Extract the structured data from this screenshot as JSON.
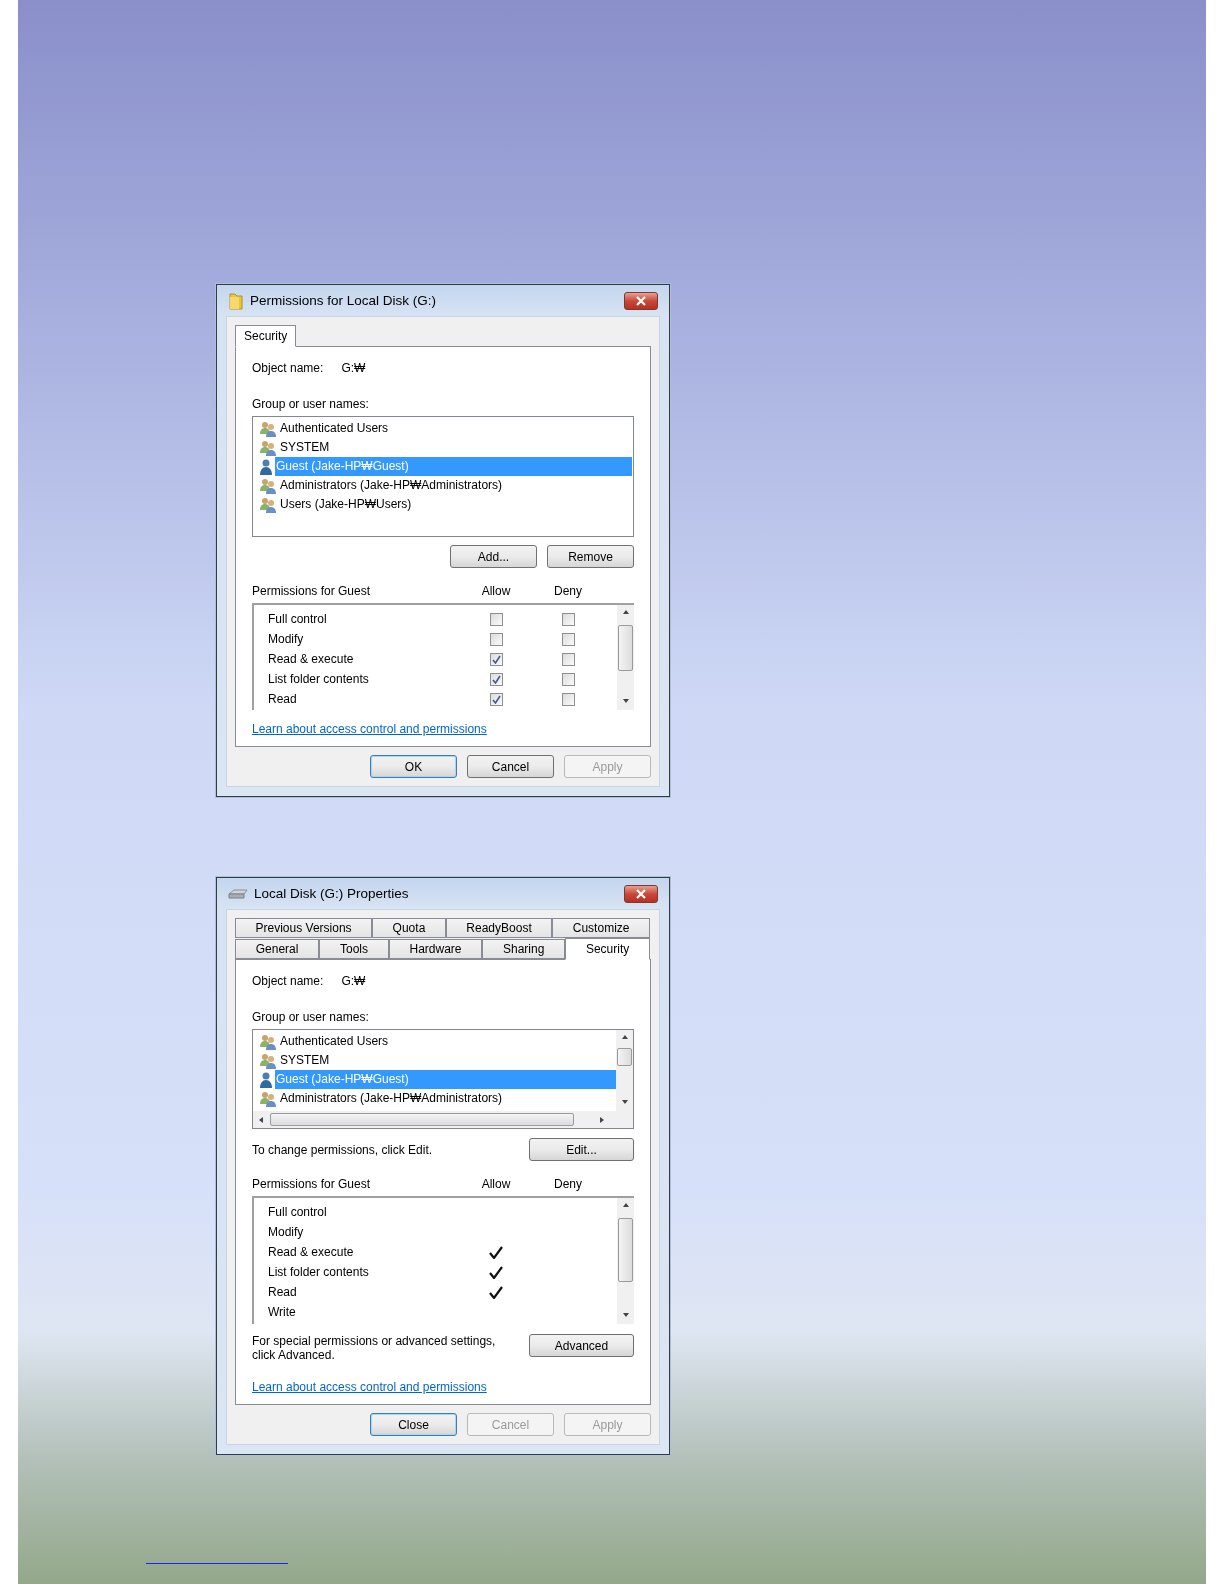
{
  "dialogs": [
    {
      "kind": "permissions",
      "title": "Permissions for Local Disk (G:)",
      "tab_rows": [
        [
          {
            "label": "Security",
            "selected": true
          }
        ]
      ],
      "object_label": "Object name:",
      "object_value": "G:₩",
      "group_label": "Group or user names:",
      "users": [
        {
          "name": "Authenticated Users",
          "kind": "group",
          "selected": false
        },
        {
          "name": "SYSTEM",
          "kind": "group",
          "selected": false
        },
        {
          "name": "Guest (Jake-HP₩Guest)",
          "kind": "user",
          "selected": true
        },
        {
          "name": "Administrators (Jake-HP₩Administrators)",
          "kind": "group",
          "selected": false
        },
        {
          "name": "Users (Jake-HP₩Users)",
          "kind": "group",
          "selected": false
        }
      ],
      "user_buttons": [
        "Add...",
        "Remove"
      ],
      "permissions_label": "Permissions for Guest",
      "allow_label": "Allow",
      "deny_label": "Deny",
      "permissions": [
        {
          "name": "Full control",
          "allow": false,
          "deny": false
        },
        {
          "name": "Modify",
          "allow": false,
          "deny": false
        },
        {
          "name": "Read & execute",
          "allow": true,
          "deny": false
        },
        {
          "name": "List folder contents",
          "allow": true,
          "deny": false
        },
        {
          "name": "Read",
          "allow": true,
          "deny": false
        }
      ],
      "link": "Learn about access control and permissions",
      "buttons": [
        {
          "label": "OK",
          "disabled": false,
          "default": true
        },
        {
          "label": "Cancel",
          "disabled": false,
          "default": false
        },
        {
          "label": "Apply",
          "disabled": true,
          "default": false
        }
      ]
    },
    {
      "kind": "properties",
      "title": "Local Disk (G:) Properties",
      "tab_rows": [
        [
          {
            "label": "Previous Versions",
            "selected": false
          },
          {
            "label": "Quota",
            "selected": false
          },
          {
            "label": "ReadyBoost",
            "selected": false
          },
          {
            "label": "Customize",
            "selected": false
          }
        ],
        [
          {
            "label": "General",
            "selected": false
          },
          {
            "label": "Tools",
            "selected": false
          },
          {
            "label": "Hardware",
            "selected": false
          },
          {
            "label": "Sharing",
            "selected": false
          },
          {
            "label": "Security",
            "selected": true
          }
        ]
      ],
      "object_label": "Object name:",
      "object_value": "G:₩",
      "group_label": "Group or user names:",
      "users": [
        {
          "name": "Authenticated Users",
          "kind": "group",
          "selected": false
        },
        {
          "name": "SYSTEM",
          "kind": "group",
          "selected": false
        },
        {
          "name": "Guest (Jake-HP₩Guest)",
          "kind": "user",
          "selected": true
        },
        {
          "name": "Administrators (Jake-HP₩Administrators)",
          "kind": "group",
          "selected": false
        }
      ],
      "edit_text": "To change permissions, click Edit.",
      "edit_button": "Edit...",
      "permissions_label": "Permissions for Guest",
      "allow_label": "Allow",
      "deny_label": "Deny",
      "permissions": [
        {
          "name": "Full control",
          "allow": false,
          "deny": false
        },
        {
          "name": "Modify",
          "allow": false,
          "deny": false
        },
        {
          "name": "Read & execute",
          "allow": true,
          "deny": false
        },
        {
          "name": "List folder contents",
          "allow": true,
          "deny": false
        },
        {
          "name": "Read",
          "allow": true,
          "deny": false
        },
        {
          "name": "Write",
          "allow": false,
          "deny": false
        }
      ],
      "advanced_text": "For special permissions or advanced settings, click Advanced.",
      "advanced_button": "Advanced",
      "link": "Learn about access control and permissions",
      "buttons": [
        {
          "label": "Close",
          "disabled": false,
          "default": true
        },
        {
          "label": "Cancel",
          "disabled": true,
          "default": false
        },
        {
          "label": "Apply",
          "disabled": true,
          "default": false
        }
      ]
    }
  ]
}
